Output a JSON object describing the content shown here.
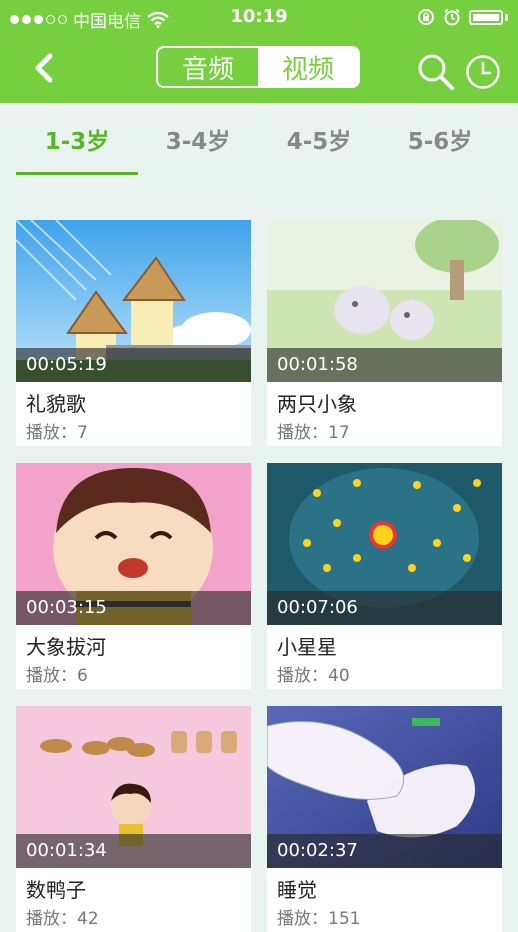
{
  "status_bar": {
    "carrier": "中国电信",
    "time": "10:19"
  },
  "header": {
    "segments": [
      "音频",
      "视频"
    ],
    "active_segment": 1
  },
  "age_tabs": [
    {
      "label": "1-3岁",
      "active": true
    },
    {
      "label": "3-4岁",
      "active": false
    },
    {
      "label": "4-5岁",
      "active": false
    },
    {
      "label": "5-6岁",
      "active": false
    }
  ],
  "videos": [
    {
      "title": "礼貌歌",
      "duration": "00:05:19",
      "plays": "播放：7"
    },
    {
      "title": "两只小象",
      "duration": "00:01:58",
      "plays": "播放：17"
    },
    {
      "title": "大象拔河",
      "duration": "00:03:15",
      "plays": "播放：6"
    },
    {
      "title": "小星星",
      "duration": "00:07:06",
      "plays": "播放：40"
    },
    {
      "title": "数鸭子",
      "duration": "00:01:34",
      "plays": "播放：42"
    },
    {
      "title": "睡觉",
      "duration": "00:02:37",
      "plays": "播放：151"
    }
  ],
  "colors": {
    "brand": "#76cf3e",
    "tab_active": "#5ab52a",
    "background": "#e9f3ef"
  }
}
